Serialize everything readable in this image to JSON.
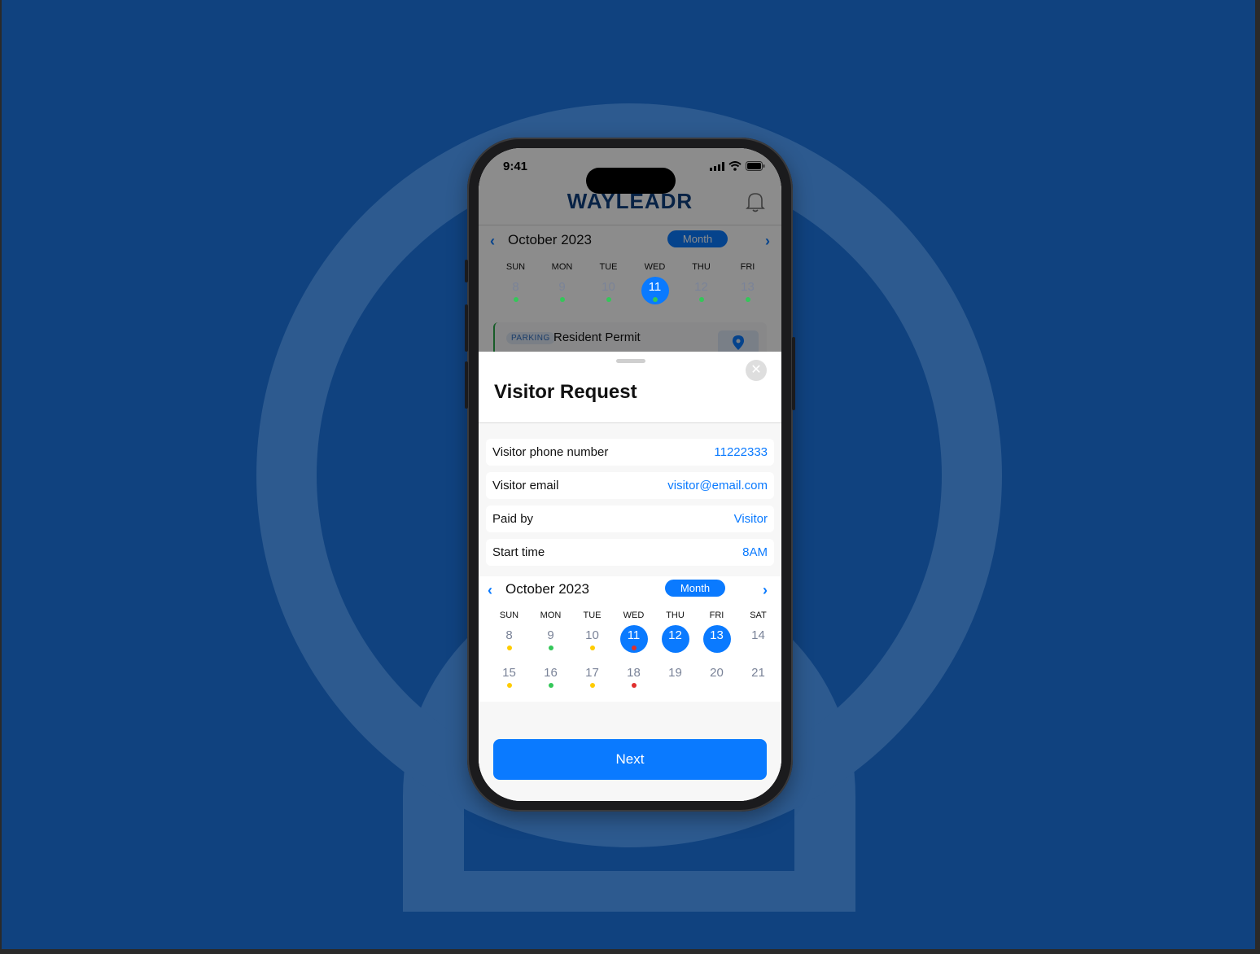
{
  "status_bar": {
    "time": "9:41"
  },
  "app": {
    "logo_text": "WAYLEADR"
  },
  "background_calendar": {
    "month_label": "October 2023",
    "view_toggle": "Month",
    "days": [
      {
        "name": "SUN",
        "date": "8",
        "dot": "#34c759",
        "selected": false
      },
      {
        "name": "MON",
        "date": "9",
        "dot": "#34c759",
        "selected": false
      },
      {
        "name": "TUE",
        "date": "10",
        "dot": "#34c759",
        "selected": false
      },
      {
        "name": "WED",
        "date": "11",
        "dot": "#34c759",
        "selected": true
      },
      {
        "name": "THU",
        "date": "12",
        "dot": "#34c759",
        "selected": false
      },
      {
        "name": "FRI",
        "date": "13",
        "dot": "#34c759",
        "selected": false
      }
    ]
  },
  "permit_card": {
    "tag": "PARKING",
    "title": "Resident Permit"
  },
  "sheet": {
    "title": "Visitor Request",
    "close_icon": "close-icon",
    "fields": [
      {
        "label": "Visitor phone number",
        "value": "11222333"
      },
      {
        "label": "Visitor email",
        "value": "visitor@email.com"
      },
      {
        "label": "Paid by",
        "value": "Visitor"
      },
      {
        "label": "Start time",
        "value": "8AM"
      }
    ],
    "calendar": {
      "month_label": "October 2023",
      "view_toggle": "Month",
      "weekday_names": [
        "SUN",
        "MON",
        "TUE",
        "WED",
        "THU",
        "FRI",
        "SAT"
      ],
      "weeks": [
        [
          {
            "date": "8",
            "dot": "#ffcc00",
            "selected": false
          },
          {
            "date": "9",
            "dot": "#34c759",
            "selected": false
          },
          {
            "date": "10",
            "dot": "#ffcc00",
            "selected": false
          },
          {
            "date": "11",
            "dot": "#e0302e",
            "selected": true
          },
          {
            "date": "12",
            "dot": null,
            "selected": true
          },
          {
            "date": "13",
            "dot": null,
            "selected": true
          },
          {
            "date": "14",
            "dot": null,
            "selected": false
          }
        ],
        [
          {
            "date": "15",
            "dot": "#ffcc00",
            "selected": false
          },
          {
            "date": "16",
            "dot": "#34c759",
            "selected": false
          },
          {
            "date": "17",
            "dot": "#ffcc00",
            "selected": false
          },
          {
            "date": "18",
            "dot": "#e0302e",
            "selected": false
          },
          {
            "date": "19",
            "dot": null,
            "selected": false
          },
          {
            "date": "20",
            "dot": null,
            "selected": false
          },
          {
            "date": "21",
            "dot": null,
            "selected": false
          }
        ]
      ]
    },
    "next_label": "Next"
  },
  "colors": {
    "accent": "#0a7aff",
    "brand_navy": "#0e3e7e",
    "background": "#10427f"
  }
}
